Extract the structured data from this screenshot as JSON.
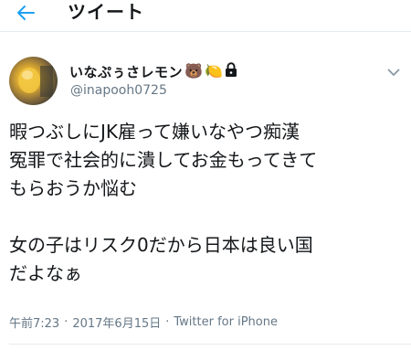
{
  "header": {
    "title": "ツイート",
    "back_icon": "arrow-left-icon"
  },
  "tweet": {
    "user": {
      "display_name": "いなぷぅさレモン",
      "handle": "@inapooh0725",
      "name_emojis": [
        "🐻",
        "🍋",
        "🔒"
      ],
      "avatar_icon": "user-avatar"
    },
    "caret_icon": "chevron-down-icon",
    "text": "暇つぶしにJK雇って嫌いなやつ痴漢\n冤罪で社会的に潰してお金もってきて\nもらおうか悩む\n\n女の子はリスク0だから日本は良い国\nだよなぁ",
    "time": "午前7:23",
    "separator": "·",
    "date": "2017年6月15日",
    "source": "Twitter for iPhone"
  },
  "colors": {
    "accent": "#1da1f2",
    "text_primary": "#14171a",
    "text_secondary": "#657786",
    "divider": "#e6ecf0"
  }
}
